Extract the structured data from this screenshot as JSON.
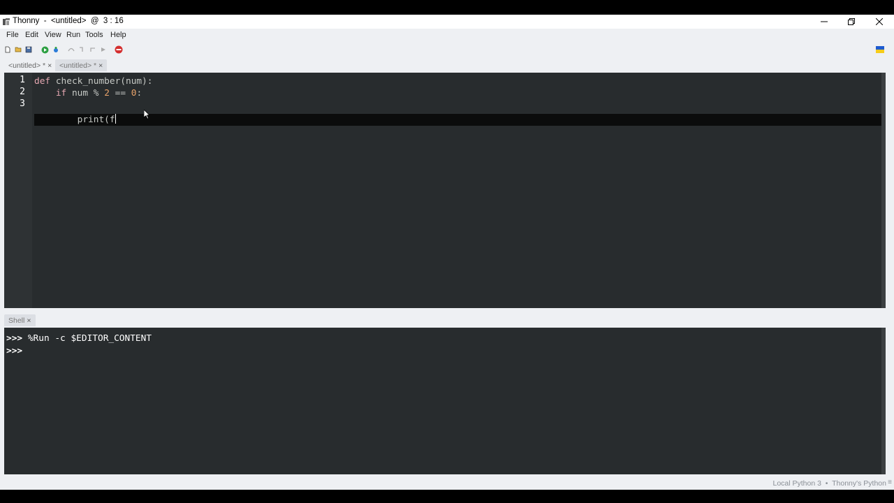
{
  "window": {
    "title": "Thonny  -  <untitled>  @  3 : 16",
    "app_icon": "thonny-icon"
  },
  "menu": [
    "File",
    "Edit",
    "View",
    "Run",
    "Tools",
    "Help"
  ],
  "toolbar": {
    "icons": [
      "new-file-icon",
      "open-file-icon",
      "save-icon",
      "run-icon",
      "debug-icon",
      "step-over-icon",
      "step-into-icon",
      "step-out-icon",
      "resume-icon",
      "stop-icon",
      "ukraine-flag-icon"
    ]
  },
  "editor_tabs": [
    {
      "label": "<untitled> *",
      "close": "×"
    },
    {
      "label": "<untitled> *",
      "close": "×"
    }
  ],
  "editor": {
    "line_numbers": [
      "1",
      "2",
      "3"
    ],
    "lines": [
      {
        "kw": "def",
        "rest": " check_number(num):"
      },
      {
        "indent": "    ",
        "kw": "if",
        "pre": " num % ",
        "num1": "2",
        "mid": " == ",
        "num2": "0",
        "post": ":"
      },
      {
        "indent": "        ",
        "text": "print(f"
      }
    ]
  },
  "shell_tab": {
    "label": "Shell",
    "close": "×"
  },
  "shell": {
    "lines": [
      {
        "prompt": ">>>",
        "cmd": " %Run -c $EDITOR_CONTENT"
      },
      {
        "prompt": ">>>",
        "cmd": ""
      }
    ]
  },
  "statusbar": {
    "text": "Local Python 3  •  Thonny's Python",
    "grip": "≡"
  },
  "colors": {
    "editor_bg": "#282c2e",
    "keyword": "#e5a7b1",
    "number": "#e8a36a"
  }
}
